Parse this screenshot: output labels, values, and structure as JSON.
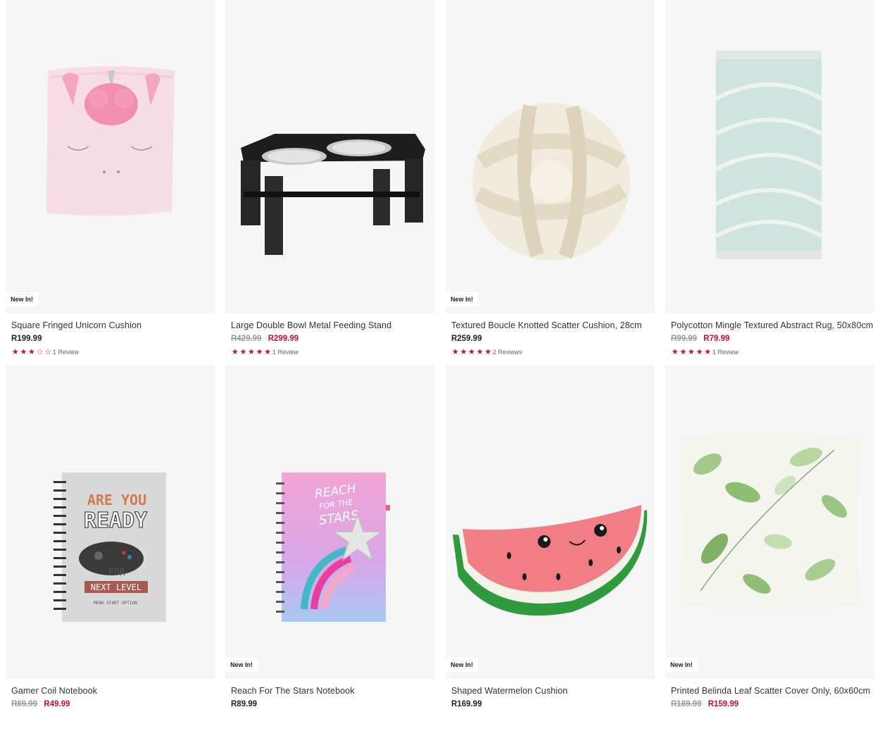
{
  "products": [
    {
      "title": "Square Fringed Unicorn Cushion",
      "badge": "New In!",
      "price": "R199.99",
      "was": "",
      "stars": 3,
      "reviews": "1 Review"
    },
    {
      "title": "Large Double Bowl Metal Feeding Stand",
      "badge": "",
      "price": "R299.99",
      "was": "R429.99",
      "stars": 5,
      "reviews": "1 Review"
    },
    {
      "title": "Textured Boucle Knotted Scatter Cushion, 28cm",
      "badge": "New In!",
      "price": "R259.99",
      "was": "",
      "stars": 5,
      "reviews": "2 Reviews"
    },
    {
      "title": "Polycotton Mingle Textured Abstract Rug, 50x80cm",
      "badge": "",
      "price": "R79.99",
      "was": "R99.99",
      "stars": 5,
      "reviews": "1 Review"
    },
    {
      "title": "Gamer Coil Notebook",
      "badge": "",
      "price": "R49.99",
      "was": "R89.99",
      "stars": 0,
      "reviews": "",
      "notebook_lines": [
        "ARE YOU",
        "READY",
        "FOR",
        "NEXT LEVEL",
        "MENU START OPTION"
      ]
    },
    {
      "title": "Reach For The Stars Notebook",
      "badge": "New In!",
      "price": "R89.99",
      "was": "",
      "stars": 0,
      "reviews": "",
      "notebook_lines": [
        "REACH",
        "FOR THE",
        "STARS"
      ]
    },
    {
      "title": "Shaped Watermelon Cushion",
      "badge": "New In!",
      "price": "R169.99",
      "was": "",
      "stars": 0,
      "reviews": ""
    },
    {
      "title": "Printed Belinda Leaf Scatter Cover Only, 60x60cm",
      "badge": "New In!",
      "price": "R159.99",
      "was": "R189.99",
      "stars": 0,
      "reviews": ""
    }
  ],
  "colors": {
    "sale": "#c8102e",
    "star": "#c8102e",
    "tile_bg": "#f6f6f6"
  }
}
